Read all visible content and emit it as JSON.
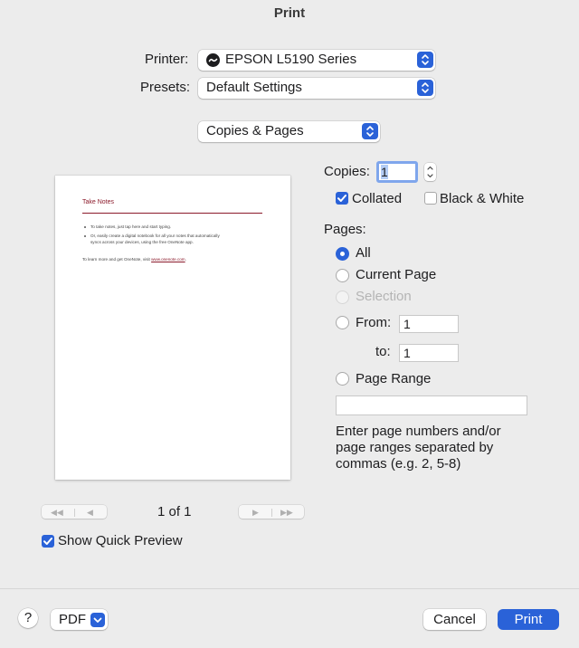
{
  "window": {
    "title": "Print"
  },
  "printer": {
    "label": "Printer:",
    "value": "EPSON L5190 Series",
    "icon": "printer-status-icon"
  },
  "presets": {
    "label": "Presets:",
    "value": "Default Settings"
  },
  "section_popup": {
    "value": "Copies & Pages"
  },
  "copies": {
    "label": "Copies:",
    "value": "1"
  },
  "collated": {
    "label": "Collated",
    "checked": true
  },
  "black_white": {
    "label": "Black & White",
    "checked": false
  },
  "pages": {
    "label": "Pages:",
    "options": [
      {
        "label": "All",
        "selected": true,
        "enabled": true
      },
      {
        "label": "Current Page",
        "selected": false,
        "enabled": true
      },
      {
        "label": "Selection",
        "selected": false,
        "enabled": false
      },
      {
        "label": "From:",
        "selected": false,
        "enabled": true
      },
      {
        "label": "Page Range",
        "selected": false,
        "enabled": true
      }
    ],
    "from_value": "1",
    "to_label": "to:",
    "to_value": "1",
    "range_value": "",
    "help_text_lines": [
      "Enter page numbers and/or",
      "page ranges separated by",
      "commas (e.g. 2, 5-8)"
    ]
  },
  "preview": {
    "doc_title": "Take Notes",
    "bullet_1": "To take notes, just tap here and start typing.",
    "bullet_2_line_1": "Or, easily create a digital notebook for all your notes that automatically",
    "bullet_2_line_2": "syncs across your devices, using the free OneNote app.",
    "footer_prefix": "To learn more and get OneNote, visit ",
    "footer_link": "www.onenote.com",
    "footer_suffix": ".",
    "page_indicator": "1 of 1",
    "first_label": "◀◀",
    "prev_label": "◀",
    "next_label": "▶",
    "last_label": "▶▶"
  },
  "show_quick_preview": {
    "label": "Show Quick Preview",
    "checked": true
  },
  "footer": {
    "help_label": "?",
    "pdf_label": "PDF",
    "cancel_label": "Cancel",
    "print_label": "Print"
  },
  "colors": {
    "accent": "#2a62d8",
    "background": "#ececec",
    "doc_accent": "#8b1a2b"
  }
}
